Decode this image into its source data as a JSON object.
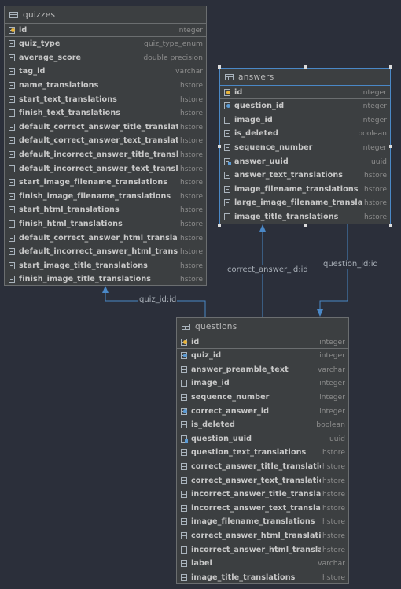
{
  "tables": {
    "quizzes": {
      "name": "quizzes",
      "columns": [
        {
          "name": "id",
          "type": "integer",
          "icon": "primary-key-icon"
        },
        {
          "name": "quiz_type",
          "type": "quiz_type_enum",
          "icon": "column-icon"
        },
        {
          "name": "average_score",
          "type": "double precision",
          "icon": "column-icon"
        },
        {
          "name": "tag_id",
          "type": "varchar",
          "icon": "column-icon"
        },
        {
          "name": "name_translations",
          "type": "hstore",
          "icon": "column-icon"
        },
        {
          "name": "start_text_translations",
          "type": "hstore",
          "icon": "column-icon"
        },
        {
          "name": "finish_text_translations",
          "type": "hstore",
          "icon": "column-icon"
        },
        {
          "name": "default_correct_answer_title_translations",
          "type": "hstore",
          "icon": "column-icon"
        },
        {
          "name": "default_correct_answer_text_translations",
          "type": "hstore",
          "icon": "column-icon"
        },
        {
          "name": "default_incorrect_answer_title_translations",
          "type": "hstore",
          "icon": "column-icon"
        },
        {
          "name": "default_incorrect_answer_text_translations",
          "type": "hstore",
          "icon": "column-icon"
        },
        {
          "name": "start_image_filename_translations",
          "type": "hstore",
          "icon": "column-icon"
        },
        {
          "name": "finish_image_filename_translations",
          "type": "hstore",
          "icon": "column-icon"
        },
        {
          "name": "start_html_translations",
          "type": "hstore",
          "icon": "column-icon"
        },
        {
          "name": "finish_html_translations",
          "type": "hstore",
          "icon": "column-icon"
        },
        {
          "name": "default_correct_answer_html_translations",
          "type": "hstore",
          "icon": "column-icon"
        },
        {
          "name": "default_incorrect_answer_html_translations",
          "type": "hstore",
          "icon": "column-icon"
        },
        {
          "name": "start_image_title_translations",
          "type": "hstore",
          "icon": "column-icon"
        },
        {
          "name": "finish_image_title_translations",
          "type": "hstore",
          "icon": "column-icon"
        }
      ]
    },
    "answers": {
      "name": "answers",
      "columns": [
        {
          "name": "id",
          "type": "integer",
          "icon": "primary-key-icon"
        },
        {
          "name": "question_id",
          "type": "integer",
          "icon": "foreign-key-icon"
        },
        {
          "name": "image_id",
          "type": "integer",
          "icon": "column-icon"
        },
        {
          "name": "is_deleted",
          "type": "boolean",
          "icon": "column-icon"
        },
        {
          "name": "sequence_number",
          "type": "integer",
          "icon": "column-icon"
        },
        {
          "name": "answer_uuid",
          "type": "uuid",
          "icon": "index-icon"
        },
        {
          "name": "answer_text_translations",
          "type": "hstore",
          "icon": "column-icon"
        },
        {
          "name": "image_filename_translations",
          "type": "hstore",
          "icon": "column-icon"
        },
        {
          "name": "large_image_filename_translations",
          "type": "hstore",
          "icon": "column-icon"
        },
        {
          "name": "image_title_translations",
          "type": "hstore",
          "icon": "column-icon"
        }
      ]
    },
    "questions": {
      "name": "questions",
      "columns": [
        {
          "name": "id",
          "type": "integer",
          "icon": "primary-key-icon"
        },
        {
          "name": "quiz_id",
          "type": "integer",
          "icon": "foreign-key-icon"
        },
        {
          "name": "answer_preamble_text",
          "type": "varchar",
          "icon": "column-icon"
        },
        {
          "name": "image_id",
          "type": "integer",
          "icon": "column-icon"
        },
        {
          "name": "sequence_number",
          "type": "integer",
          "icon": "column-icon"
        },
        {
          "name": "correct_answer_id",
          "type": "integer",
          "icon": "foreign-key-icon"
        },
        {
          "name": "is_deleted",
          "type": "boolean",
          "icon": "column-icon"
        },
        {
          "name": "question_uuid",
          "type": "uuid",
          "icon": "index-icon"
        },
        {
          "name": "question_text_translations",
          "type": "hstore",
          "icon": "column-icon"
        },
        {
          "name": "correct_answer_title_translations",
          "type": "hstore",
          "icon": "column-icon"
        },
        {
          "name": "correct_answer_text_translations",
          "type": "hstore",
          "icon": "column-icon"
        },
        {
          "name": "incorrect_answer_title_translations",
          "type": "hstore",
          "icon": "column-icon"
        },
        {
          "name": "incorrect_answer_text_translations",
          "type": "hstore",
          "icon": "column-icon"
        },
        {
          "name": "image_filename_translations",
          "type": "hstore",
          "icon": "column-icon"
        },
        {
          "name": "correct_answer_html_translations",
          "type": "hstore",
          "icon": "column-icon"
        },
        {
          "name": "incorrect_answer_html_translations",
          "type": "hstore",
          "icon": "column-icon"
        },
        {
          "name": "label",
          "type": "varchar",
          "icon": "column-icon"
        },
        {
          "name": "image_title_translations",
          "type": "hstore",
          "icon": "column-icon"
        }
      ]
    }
  },
  "relations": {
    "quiz": "quiz_id:id",
    "correct_answer": "correct_answer_id:id",
    "question": "question_id:id"
  },
  "colors": {
    "background": "#2b2f3a",
    "table_bg": "#3c3f41",
    "selected_border": "#4a88c7",
    "link": "#4a88c7"
  }
}
